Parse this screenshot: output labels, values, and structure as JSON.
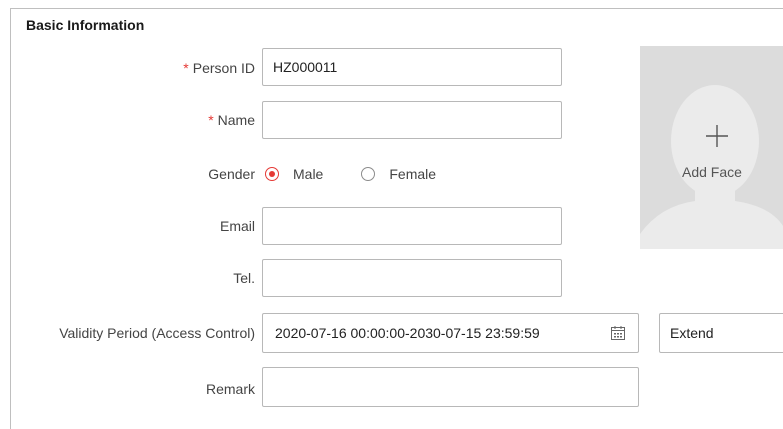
{
  "section": {
    "title": "Basic Information"
  },
  "form": {
    "person_id": {
      "label": "Person ID",
      "required_mark": "*",
      "value": "HZ000011"
    },
    "name": {
      "label": "Name",
      "required_mark": "*",
      "value": ""
    },
    "gender": {
      "label": "Gender",
      "options": [
        "Male",
        "Female"
      ],
      "selected": "Male"
    },
    "email": {
      "label": "Email",
      "value": ""
    },
    "tel": {
      "label": "Tel.",
      "value": ""
    },
    "validity": {
      "label": "Validity Period (Access Control)",
      "value": "2020-07-16 00:00:00-2030-07-15 23:59:59",
      "icon": "calendar-icon"
    },
    "extend": {
      "value": "Extend"
    },
    "remark": {
      "label": "Remark",
      "value": ""
    }
  },
  "face": {
    "label": "Add Face",
    "icon": "plus-icon"
  },
  "colors": {
    "required": "#e53935",
    "radio_selected": "#e53935",
    "face_bg": "#dcdcdc",
    "silhouette": "#ebebeb"
  }
}
